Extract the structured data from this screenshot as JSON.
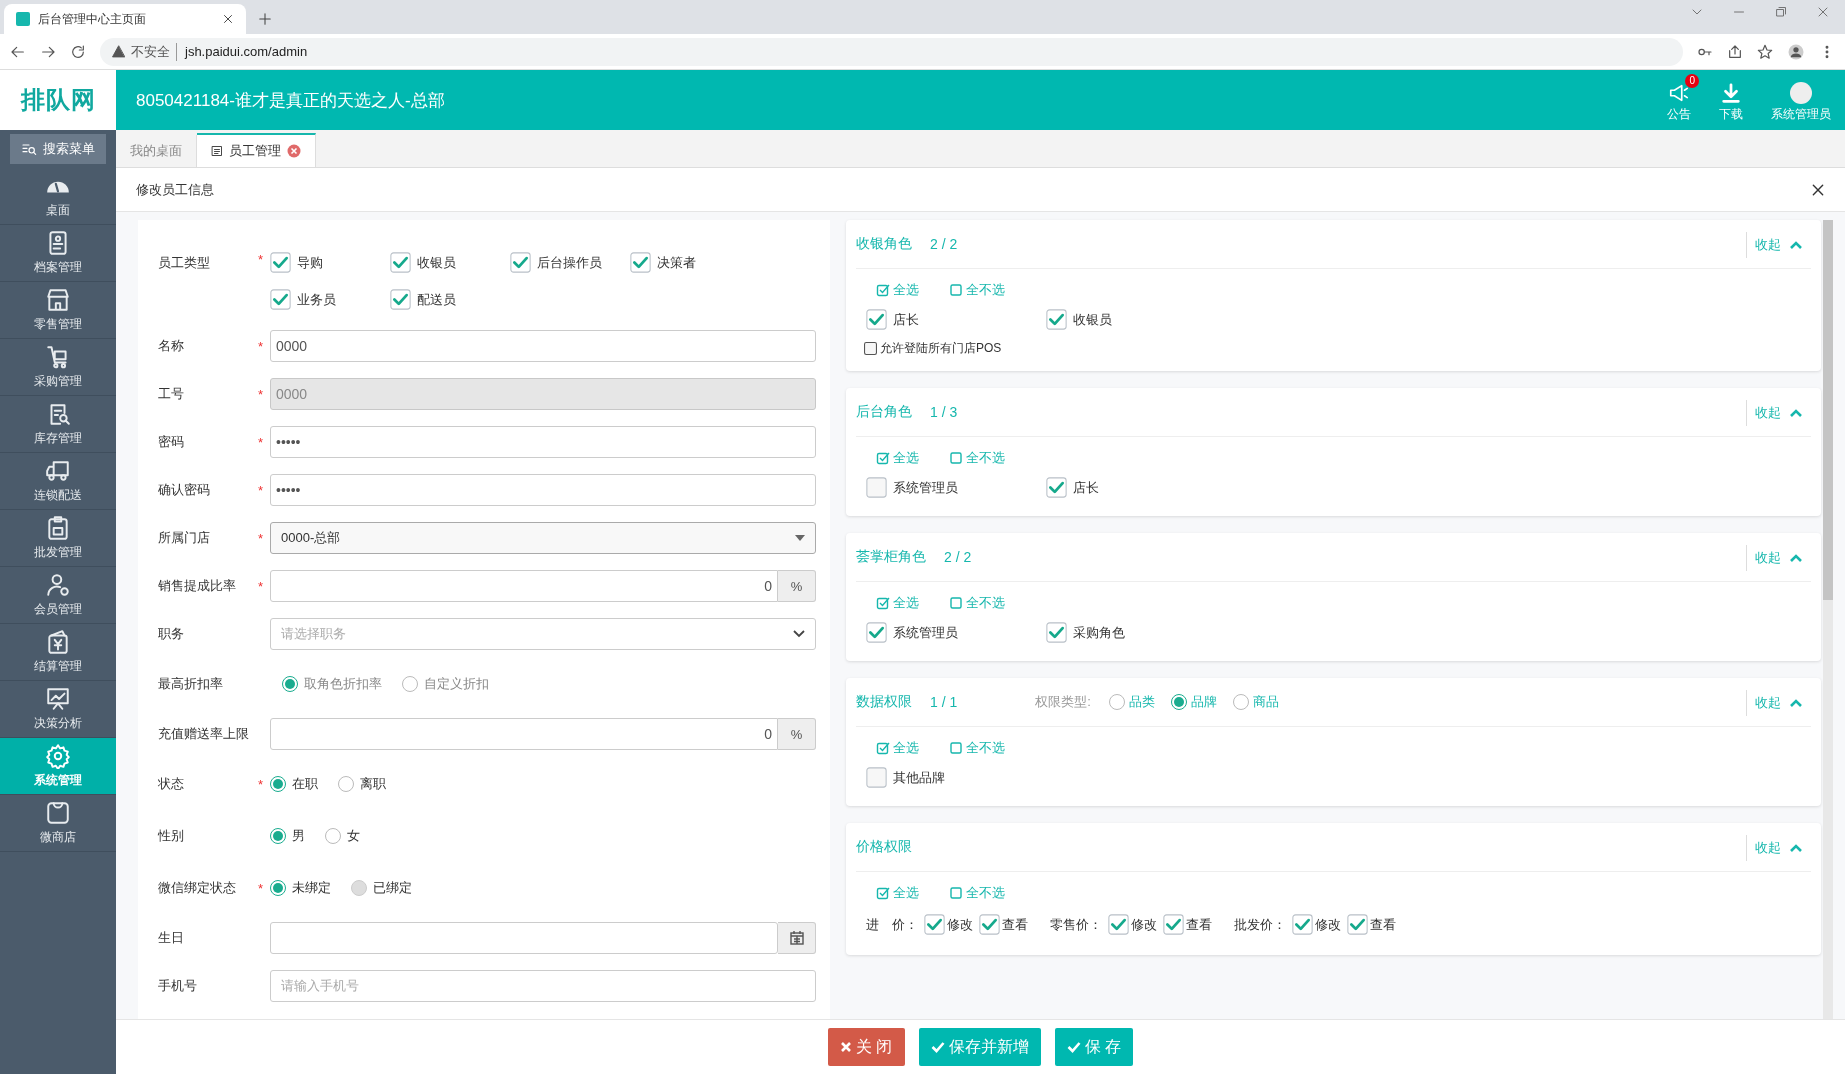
{
  "browser": {
    "tab_title": "后台管理中心主页面",
    "security": "不安全",
    "url": "jsh.paidui.com/admin"
  },
  "header": {
    "logo": "排队网",
    "title": "8050421184-谁才是真正的天选之人-总部",
    "notice": {
      "label": "公告",
      "badge": "0"
    },
    "download": {
      "label": "下载"
    },
    "user": {
      "label": "系统管理员"
    }
  },
  "sidebar": {
    "search": "搜索菜单",
    "items": [
      {
        "label": "桌面",
        "selected": false
      },
      {
        "label": "档案管理",
        "selected": false
      },
      {
        "label": "零售管理",
        "selected": false
      },
      {
        "label": "采购管理",
        "selected": false
      },
      {
        "label": "库存管理",
        "selected": false
      },
      {
        "label": "连锁配送",
        "selected": false
      },
      {
        "label": "批发管理",
        "selected": false
      },
      {
        "label": "会员管理",
        "selected": false
      },
      {
        "label": "结算管理",
        "selected": false
      },
      {
        "label": "决策分析",
        "selected": false
      },
      {
        "label": "系统管理",
        "selected": true
      },
      {
        "label": "微商店",
        "selected": false
      }
    ]
  },
  "tabs": [
    {
      "label": "我的桌面",
      "selected": false
    },
    {
      "label": "员工管理",
      "selected": true
    }
  ],
  "dialog": {
    "title": "修改员工信息"
  },
  "form": [
    {
      "kind": "checkboxes",
      "label": "员工类型",
      "asterisk": "*",
      "options": [
        {
          "label": "导购",
          "checked": true
        },
        {
          "label": "收银员",
          "checked": true
        },
        {
          "label": "后台操作员",
          "checked": true
        },
        {
          "label": "决策者",
          "checked": true
        },
        {
          "label": "业务员",
          "checked": true
        },
        {
          "label": "配送员",
          "checked": true
        }
      ]
    },
    {
      "kind": "text",
      "label": "名称",
      "asterisk": "*",
      "value": "0000",
      "disabled": false
    },
    {
      "kind": "text",
      "label": "工号",
      "asterisk": "*",
      "value": "0000",
      "disabled": true
    },
    {
      "kind": "text",
      "label": "密码",
      "asterisk": "*",
      "value": "•••••",
      "disabled": false
    },
    {
      "kind": "text",
      "label": "确认密码",
      "asterisk": "*",
      "value": "•••••",
      "disabled": false
    },
    {
      "kind": "select",
      "label": "所属门店",
      "asterisk": "*",
      "value": "0000-总部"
    },
    {
      "kind": "addon",
      "label": "销售提成比率",
      "asterisk": "*",
      "value": "0",
      "addon": "%"
    },
    {
      "kind": "dropdown",
      "label": "职务",
      "placeholder": "请选择职务"
    },
    {
      "kind": "radios",
      "label": "最高折扣率",
      "disabled": true,
      "options": [
        {
          "label": "取角色折扣率",
          "selected": true
        },
        {
          "label": "自定义折扣",
          "selected": false
        }
      ]
    },
    {
      "kind": "addon",
      "label": "充值赠送率上限",
      "value": "0",
      "addon": "%"
    },
    {
      "kind": "radios",
      "label": "状态",
      "asterisk": "*",
      "options": [
        {
          "label": "在职",
          "selected": true,
          "disabled": false
        },
        {
          "label": "离职",
          "selected": false,
          "disabled": false
        }
      ]
    },
    {
      "kind": "radios",
      "label": "性别",
      "options": [
        {
          "label": "男",
          "selected": true,
          "disabled": false
        },
        {
          "label": "女",
          "selected": false,
          "disabled": false
        }
      ]
    },
    {
      "kind": "radios",
      "label": "微信绑定状态",
      "asterisk": "*",
      "options": [
        {
          "label": "未绑定",
          "selected": true,
          "disabled": false
        },
        {
          "label": "已绑定",
          "selected": false,
          "disabled": true
        }
      ]
    },
    {
      "kind": "date",
      "label": "生日"
    },
    {
      "kind": "text",
      "label": "手机号",
      "placeholder": "请输入手机号",
      "disabled": false
    }
  ],
  "panels": [
    {
      "title": "收银角色",
      "count": "2 / 2",
      "collapse": "收起",
      "select_all": "全选",
      "select_none": "全不选",
      "items": [
        {
          "label": "店长",
          "checked": true
        },
        {
          "label": "收银员",
          "checked": true
        }
      ],
      "extra": {
        "label": "允许登陆所有门店POS",
        "checked": false
      }
    },
    {
      "title": "后台角色",
      "count": "1 / 3",
      "collapse": "收起",
      "select_all": "全选",
      "select_none": "全不选",
      "items": [
        {
          "label": "系统管理员",
          "checked": false
        },
        {
          "label": "店长",
          "checked": true
        }
      ]
    },
    {
      "title": "荟掌柜角色",
      "count": "2 / 2",
      "collapse": "收起",
      "select_all": "全选",
      "select_none": "全不选",
      "items": [
        {
          "label": "系统管理员",
          "checked": true
        },
        {
          "label": "采购角色",
          "checked": true
        }
      ]
    },
    {
      "title": "数据权限",
      "count": "1 / 1",
      "type_label": "权限类型:",
      "types": [
        {
          "label": "品类",
          "selected": false
        },
        {
          "label": "品牌",
          "selected": true
        },
        {
          "label": "商品",
          "selected": false
        }
      ],
      "collapse": "收起",
      "select_all": "全选",
      "select_none": "全不选",
      "items": [
        {
          "label": "其他品牌",
          "checked": false
        }
      ]
    },
    {
      "title": "价格权限",
      "collapse": "收起",
      "select_all": "全选",
      "select_none": "全不选",
      "price_groups": [
        {
          "label": "进　价：",
          "options": [
            {
              "label": "修改",
              "checked": true
            },
            {
              "label": "查看",
              "checked": true
            }
          ]
        },
        {
          "label": "零售价：",
          "options": [
            {
              "label": "修改",
              "checked": true
            },
            {
              "label": "查看",
              "checked": true
            }
          ]
        },
        {
          "label": "批发价：",
          "options": [
            {
              "label": "修改",
              "checked": true
            },
            {
              "label": "查看",
              "checked": true
            }
          ]
        }
      ]
    }
  ],
  "buttons": [
    {
      "label": "关 闭",
      "kind": "danger"
    },
    {
      "label": "保存并新增",
      "kind": "primary"
    },
    {
      "label": "保 存",
      "kind": "primary"
    }
  ]
}
